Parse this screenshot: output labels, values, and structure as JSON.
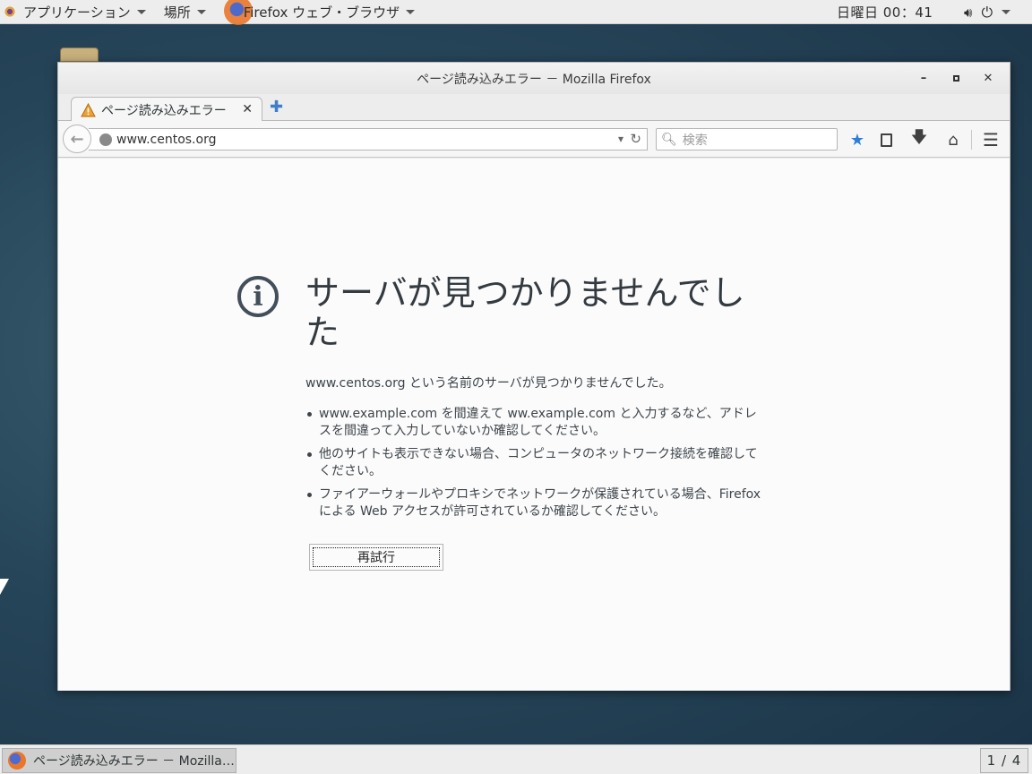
{
  "topbar": {
    "apps_label": "アプリケーション",
    "places_label": "場所",
    "active_app_label": "Firefox ウェブ・ブラウザ",
    "clock": "日曜日 00：41"
  },
  "window": {
    "title": "ページ読み込みエラー － Mozilla Firefox",
    "tab_label": "ページ読み込みエラー",
    "url": "www.centos.org",
    "search_placeholder": "検索"
  },
  "error_page": {
    "title": "サーバが見つかりませんでした",
    "description": "www.centos.org という名前のサーバが見つかりませんでした。",
    "suggestions": [
      "www.example.com を間違えて ww.example.com と入力するなど、アドレスを間違って入力していないか確認してください。",
      "他のサイトも表示できない場合、コンピュータのネットワーク接続を確認してください。",
      "ファイアーウォールやプロキシでネットワークが保護されている場合、Firefox による Web アクセスが許可されているか確認してください。"
    ],
    "retry_label": "再試行"
  },
  "taskbar": {
    "task_label": "ページ読み込みエラー － Mozilla…",
    "workspace": "1 / 4"
  }
}
